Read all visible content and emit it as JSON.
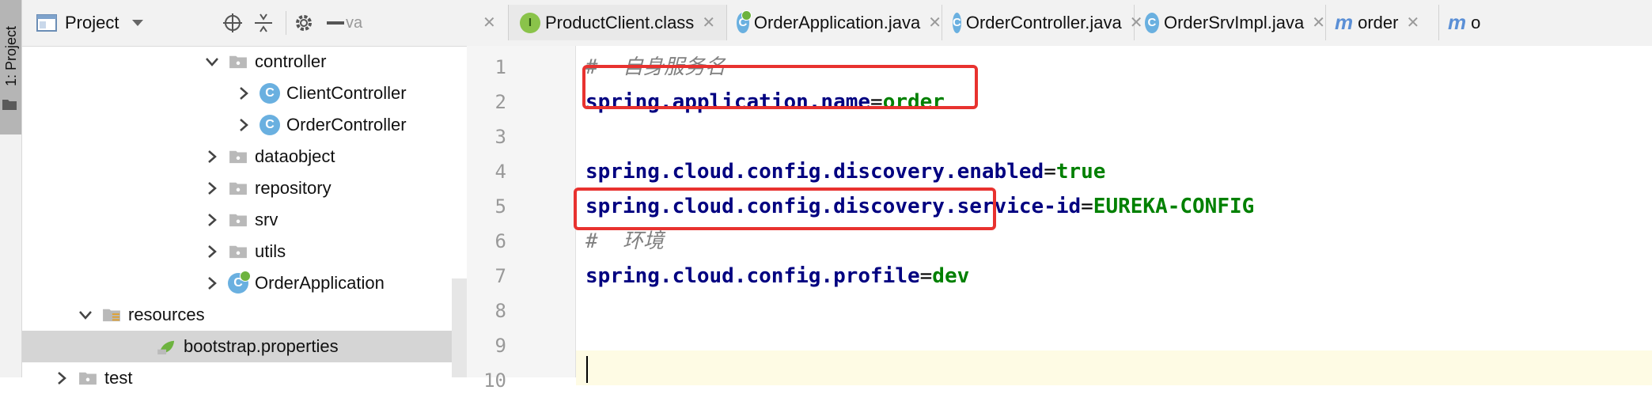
{
  "toolwindow": {
    "label": "1: Project"
  },
  "project": {
    "title": "Project",
    "header_overflow": "va",
    "tree": [
      {
        "label": "controller",
        "icon": "package-folder-icon",
        "expanded": true
      },
      {
        "label": "ClientController",
        "icon": "class-icon",
        "expanded": false
      },
      {
        "label": "OrderController",
        "icon": "class-icon",
        "expanded": false
      },
      {
        "label": "dataobject",
        "icon": "package-folder-icon",
        "expanded": false
      },
      {
        "label": "repository",
        "icon": "package-folder-icon",
        "expanded": false
      },
      {
        "label": "srv",
        "icon": "package-folder-icon",
        "expanded": false
      },
      {
        "label": "utils",
        "icon": "package-folder-icon",
        "expanded": false
      },
      {
        "label": "OrderApplication",
        "icon": "spring-app-class-icon",
        "expanded": false
      },
      {
        "label": "resources",
        "icon": "resources-folder-icon",
        "expanded": true
      },
      {
        "label": "bootstrap.properties",
        "icon": "spring-properties-file-icon",
        "selected": true
      },
      {
        "label": "test",
        "icon": "folder-icon",
        "expanded": false
      }
    ]
  },
  "tabs": [
    {
      "label": "ProductClient.class",
      "icon": "interface-icon",
      "active": true
    },
    {
      "label": "OrderApplication.java",
      "icon": "spring-app-class-icon"
    },
    {
      "label": "OrderController.java",
      "icon": "class-icon"
    },
    {
      "label": "OrderSrvImpl.java",
      "icon": "class-icon"
    },
    {
      "label": "order",
      "icon": "maven-icon"
    },
    {
      "label": "o",
      "icon": "maven-icon"
    }
  ],
  "editor": {
    "line_numbers": [
      "1",
      "2",
      "3",
      "4",
      "5",
      "6",
      "7",
      "8",
      "9",
      "10"
    ],
    "lines": [
      {
        "type": "comment",
        "text": "#  自身服务名"
      },
      {
        "type": "prop",
        "key": "spring.application.name",
        "value": "order",
        "highlighted": true
      },
      {
        "type": "blank"
      },
      {
        "type": "prop",
        "key": "spring.cloud.config.discovery.enabled",
        "value": "true"
      },
      {
        "type": "prop",
        "key": "spring.cloud.config.discovery.service-id",
        "value": "EUREKA-CONFIG"
      },
      {
        "type": "comment",
        "text": "#  环境"
      },
      {
        "type": "prop",
        "key": "spring.cloud.config.profile",
        "value": "dev",
        "highlighted": true
      },
      {
        "type": "blank"
      },
      {
        "type": "blank"
      },
      {
        "type": "blank",
        "current": true
      }
    ]
  },
  "colors": {
    "highlight_box": "#e8322f",
    "property_key": "#000080",
    "property_value": "#008000",
    "comment": "#808080"
  }
}
